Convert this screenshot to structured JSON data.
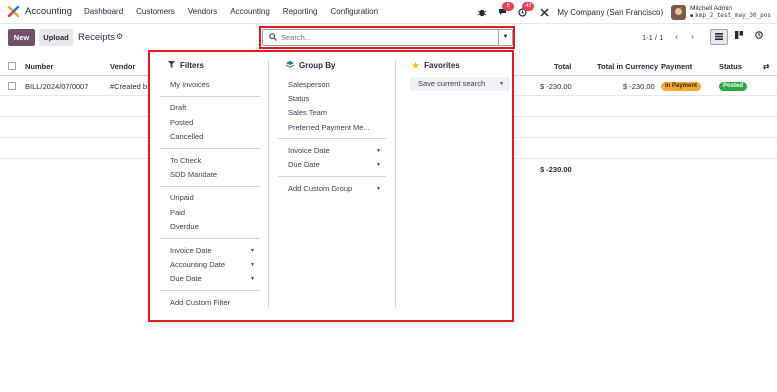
{
  "nav": {
    "app_name": "Accounting",
    "menu": [
      "Dashboard",
      "Customers",
      "Vendors",
      "Accounting",
      "Reporting",
      "Configuration"
    ],
    "badges": {
      "chat": "8",
      "activity": "43"
    },
    "company": "My Company (San Francisco)",
    "user_name": "Mitchell Admin",
    "db_name": "kmp_2_test_may_30_pos"
  },
  "control": {
    "new_label": "New",
    "upload_label": "Upload",
    "breadcrumb": "Receipts",
    "search_placeholder": "Search...",
    "pager": "1-1 / 1"
  },
  "table": {
    "headers": {
      "number": "Number",
      "vendor": "Vendor",
      "total": "Total",
      "total_currency": "Total in Currency",
      "payment": "Payment",
      "status": "Status"
    },
    "rows": [
      {
        "number": "BILL/2024/07/0007",
        "vendor": "#Created b",
        "total": "$ -230.00",
        "total_currency": "$ -230.00",
        "payment": "In Payment",
        "status": "Posted"
      }
    ],
    "footer_total": "$ -230.00"
  },
  "dropdown": {
    "filters": {
      "title": "Filters",
      "items": [
        "My Invoices",
        "Draft",
        "Posted",
        "Cancelled",
        "To Check",
        "SDD Mandate",
        "Unpaid",
        "Paid",
        "Overdue",
        "Invoice Date",
        "Accounting Date",
        "Due Date",
        "Add Custom Filter"
      ]
    },
    "group_by": {
      "title": "Group By",
      "items": [
        "Salesperson",
        "Status",
        "Sales Team",
        "Preferred Payment Me...",
        "Invoice Date",
        "Due Date",
        "Add Custom Group"
      ]
    },
    "favorites": {
      "title": "Favorites",
      "items": [
        "Save current search"
      ]
    }
  },
  "colors": {
    "accent": "#71506b",
    "highlight_box": "#e01b24",
    "in_payment": "#f3a93c",
    "posted": "#28a745"
  }
}
